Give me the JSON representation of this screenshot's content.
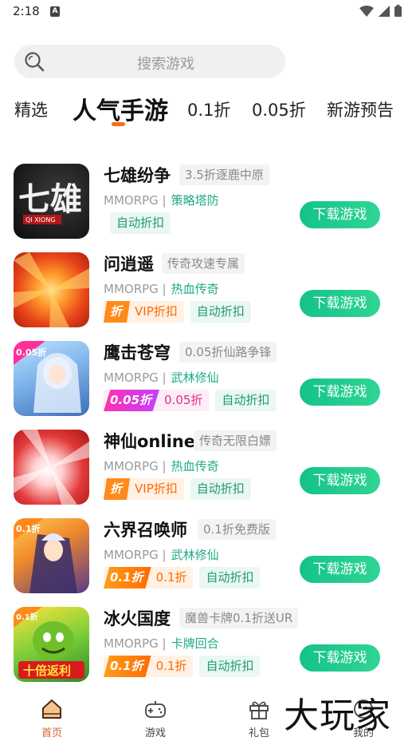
{
  "status": {
    "time": "2:18",
    "sim_icon": "A"
  },
  "search": {
    "placeholder": "搜索游戏"
  },
  "tabs": [
    "精选",
    "人气手游",
    "0.1折",
    "0.05折",
    "新游预告"
  ],
  "active_tab": "人气手游",
  "games": [
    {
      "name": "七雄纷争",
      "desc": "3.5折逐鹿中原",
      "type": "MMORPG |",
      "genre": "策略塔防",
      "badge": null,
      "discount": null,
      "auto": "自动折扣",
      "button": "下载游戏",
      "thumb_text": "七雄",
      "thumb_sub": "QI XIONG"
    },
    {
      "name": "问逍遥",
      "desc": "传奇攻速专属",
      "type": "MMORPG |",
      "genre": "热血传奇",
      "badge": "折",
      "badge_style": "vip",
      "discount": "VIP折扣",
      "auto": "自动折扣",
      "button": "下载游戏"
    },
    {
      "name": "鹰击苍穹",
      "desc": "0.05折仙路争锋",
      "type": "MMORPG |",
      "genre": "武林修仙",
      "badge": "0.05折",
      "badge_style": "pink",
      "discount": "0.05折",
      "auto": "自动折扣",
      "button": "下载游戏",
      "thumb_corner": "0.05折"
    },
    {
      "name": "神仙online",
      "desc": "传奇无限白嫖",
      "type": "MMORPG |",
      "genre": "热血传奇",
      "badge": "折",
      "badge_style": "vip",
      "discount": "VIP折扣",
      "auto": "自动折扣",
      "button": "下载游戏"
    },
    {
      "name": "六界召唤师",
      "desc": "0.1折免费版",
      "type": "MMORPG |",
      "genre": "武林修仙",
      "badge": "0.1折",
      "badge_style": "orange",
      "discount": "0.1折",
      "auto": "自动折扣",
      "button": "下载游戏",
      "thumb_corner": "0.1折"
    },
    {
      "name": "冰火国度",
      "desc": "魔兽卡牌0.1折送UR",
      "type": "MMORPG |",
      "genre": "卡牌回合",
      "badge": "0.1折",
      "badge_style": "orange",
      "discount": "0.1折",
      "auto": "自动折扣",
      "button": "下载游戏",
      "thumb_corner": "0.1折",
      "thumb_banner": "十倍返利"
    }
  ],
  "bottom_nav": [
    {
      "label": "首页",
      "icon": "home-icon",
      "active": true
    },
    {
      "label": "游戏",
      "icon": "gamepad-icon",
      "active": false
    },
    {
      "label": "礼包",
      "icon": "gift-icon",
      "active": false
    },
    {
      "label": "我的",
      "icon": "profile-icon",
      "active": false
    }
  ],
  "watermark": "大玩家",
  "colors": {
    "accent_orange": "#ff6a1a",
    "button_green": "#1ccb8f",
    "genre_green": "#1eaa86"
  }
}
